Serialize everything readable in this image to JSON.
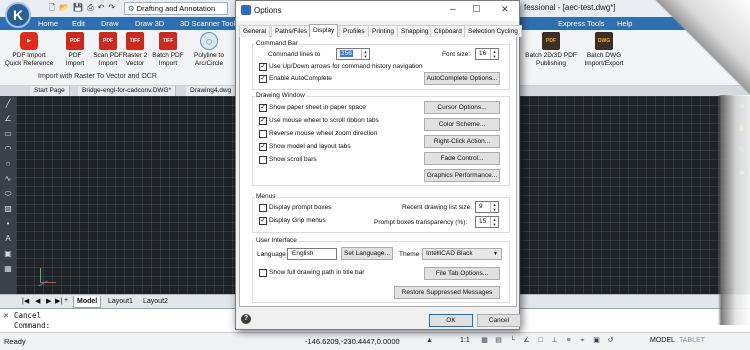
{
  "app": {
    "logo_letter": "K",
    "workspace": "Drafting and Annotation",
    "window_title_fragment": "fessional - [aec-test.dwg*]"
  },
  "menubar": [
    "Home",
    "Edit",
    "Draw",
    "Draw 3D",
    "3D Scanner Tools",
    "Express Tools",
    "Help"
  ],
  "ribbon": {
    "buttons": [
      {
        "icon": "video-icon",
        "line1": "PDF Import",
        "line2": "Quick Reference"
      },
      {
        "icon": "pdf-icon",
        "line1": "PDF",
        "line2": "Import"
      },
      {
        "icon": "pdf-icon",
        "line1": "Scan PDF",
        "line2": "Import"
      },
      {
        "icon": "tiff-icon",
        "line1": "Raster 2",
        "line2": "Vector"
      },
      {
        "icon": "tiff-icon",
        "line1": "Batch PDF",
        "line2": "Import"
      },
      {
        "icon": "polyline-icon",
        "line1": "Polyline to",
        "line2": "Arc/Circle"
      },
      {
        "icon": "pdf-icon",
        "line1": "Batch 2D/3D PDF",
        "line2": "Publishing"
      },
      {
        "icon": "dwg-icon",
        "line1": "Batch DWG",
        "line2": "Import/Export"
      }
    ],
    "group_label": "Import with Raster To Vector and OCR"
  },
  "doc_tabs": [
    "Start Page",
    "Bridge-engl-for-cadconv.DWG*",
    "Drawing4.dwg"
  ],
  "layout_tabs": [
    "Model",
    "Layout1",
    "Layout2"
  ],
  "command": {
    "line1": "Cancel",
    "line2": "Command:"
  },
  "status": {
    "ready": "Ready",
    "coords": "-146.6209,-230.4447,0.0000",
    "scale": "1:1",
    "model": "MODEL",
    "tablet": "TABLET"
  },
  "dialog": {
    "title": "Options",
    "tabs": [
      "General",
      "Paths/Files",
      "Display",
      "Profiles",
      "Printing",
      "Snapping",
      "Clipboard",
      "Selection Cycling"
    ],
    "active_tab": "Display",
    "command_bar": {
      "title": "Command Bar",
      "lines_label": "Command lines to",
      "lines_value": "256",
      "font_size_label": "Font size:",
      "font_size_value": "16",
      "updown_label": "Use Up/Down arrows for command history navigation",
      "updown_checked": true,
      "autocomplete_label": "Enable AutoComplete",
      "autocomplete_checked": true,
      "autocomplete_button": "AutoComplete Options..."
    },
    "drawing_window": {
      "title": "Drawing Window",
      "options": [
        {
          "label": "Show paper sheet in paper space",
          "checked": true
        },
        {
          "label": "Use mouse wheel to scroll ribbon tabs",
          "checked": true
        },
        {
          "label": "Reverse mouse wheel zoom direction",
          "checked": false
        },
        {
          "label": "Show model and layout tabs",
          "checked": true
        },
        {
          "label": "Show scroll bars",
          "checked": false
        }
      ],
      "buttons": [
        "Cursor Options...",
        "Color Scheme...",
        "Right-Click Action...",
        "Fade Control...",
        "Graphics Performance..."
      ]
    },
    "menus": {
      "title": "Menus",
      "prompt_boxes_label": "Display prompt boxes",
      "prompt_boxes_checked": false,
      "grip_menus_label": "Display Grip menus",
      "grip_menus_checked": true,
      "recent_list_label": "Recent drawing list size:",
      "recent_list_value": "9",
      "transparency_label": "Prompt boxes transparency (%):",
      "transparency_value": "15"
    },
    "user_interface": {
      "title": "User Interface",
      "language_label": "Language",
      "language_value": "English",
      "set_language_button": "Set Language...",
      "theme_label": "Theme",
      "theme_value": "IntelliCAD Black",
      "full_path_label": "Show full drawing path in title bar",
      "full_path_checked": false,
      "file_tab_button": "File Tab Options...",
      "restore_button": "Restore Suppressed Messages"
    },
    "ok_label": "OK",
    "cancel_label": "Cancel",
    "help_glyph": "?"
  }
}
